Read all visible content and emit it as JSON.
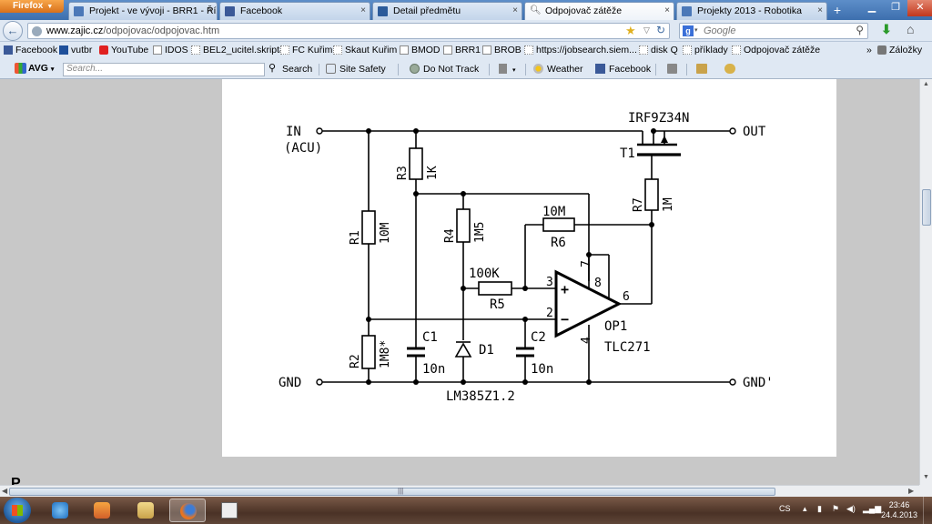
{
  "browser": {
    "menu_button": "Firefox",
    "tabs": [
      {
        "label": "Projekt - ve vývoji - BRR1 - Říze…",
        "active": false
      },
      {
        "label": "Facebook",
        "active": false
      },
      {
        "label": "Detail předmětu",
        "active": false
      },
      {
        "label": "Odpojovač zátěže",
        "active": true
      },
      {
        "label": "Projekty 2013 - Robotika",
        "active": false
      }
    ],
    "new_tab": "+",
    "url_host": "www.zajic.cz",
    "url_path": "/odpojovac/odpojovac.htm",
    "search_placeholder": "Google",
    "bookmarks": [
      "Facebook",
      "vutbr",
      "YouTube",
      "IDOS",
      "BEL2_ucitel.skripta",
      "FC Kuřim",
      "Skaut Kuřim",
      "BMOD",
      "BRR1",
      "BROB",
      "https://jobsearch.siem...",
      "disk Q",
      "příklady",
      "Odpojovač zátěže"
    ],
    "bookmarks_more": "»",
    "bookmarks_folder": "Záložky",
    "toolbar": {
      "logo": "AVG",
      "search_placeholder": "Search...",
      "search_button": "Search",
      "site_safety": "Site Safety",
      "do_not_track": "Do Not Track",
      "weather": "Weather",
      "facebook": "Facebook"
    }
  },
  "schematic": {
    "labels": {
      "in": "IN",
      "acu": "(ACU)",
      "out": "OUT",
      "gnd": "GND",
      "gnd_out": "GND'",
      "mosfet": "IRF9Z34N",
      "t1": "T1",
      "r1": "R1",
      "r1_val": "10M",
      "r2": "R2",
      "r2_val": "1M8*",
      "r3": "R3",
      "r3_val": "1K",
      "r4": "R4",
      "r4_val": "1M5",
      "r5": "R5",
      "r5_val": "100K",
      "r6": "R6",
      "r6_val": "10M",
      "r7": "R7",
      "r7_val": "1M",
      "c1": "C1",
      "c1_val": "10n",
      "c2": "C2",
      "c2_val": "10n",
      "d1": "D1",
      "ref": "LM385Z1.2",
      "op": "OP1",
      "op_type": "TLC271",
      "pin2": "2",
      "pin3": "3",
      "pin4": "4",
      "pin6": "6",
      "pin7": "7",
      "pin8": "8",
      "plus": "+",
      "minus": "−"
    }
  },
  "page_heading_peek": "P",
  "taskbar": {
    "language": "CS",
    "time": "23:46",
    "date": "24.4.2013"
  }
}
